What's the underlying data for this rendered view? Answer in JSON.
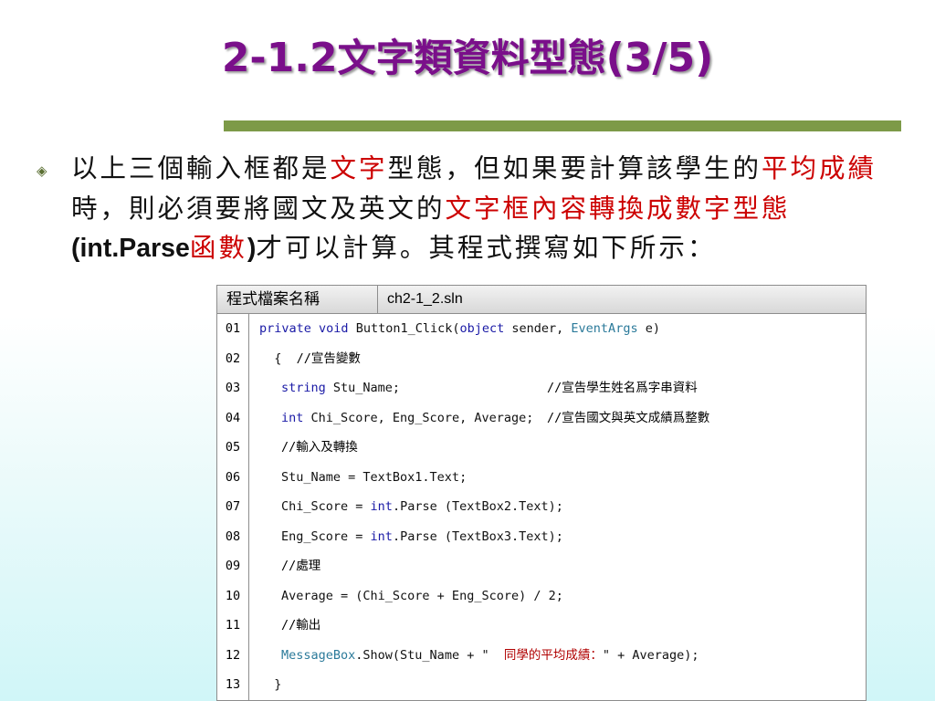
{
  "slide": {
    "title_prefix": "2-1.2",
    "title_cn": "文字類資料型態",
    "title_suffix": "(3/5)",
    "bullet_icon": "diamond-bullet-icon",
    "paragraph": {
      "p1": "以上三個輸入框都是",
      "p2_red": "文字",
      "p3": "型態，但如果要計算該學生的",
      "p4_red": "平均成績",
      "p5": "時，則必須要將國文及英文的",
      "p6_red": "文字框內容轉換成數字型態",
      "p7_paren_open": "(",
      "p8_en": "int.Parse",
      "p9_red": "函數",
      "p10_paren_close": ")",
      "p11": "才可以計算。其程式撰寫如下所示："
    }
  },
  "code_window": {
    "label": "程式檔案名稱",
    "filename": "ch2-1_2.sln",
    "line_numbers": [
      "01",
      "02",
      "03",
      "04",
      "05",
      "06",
      "07",
      "08",
      "09",
      "10",
      "11",
      "12",
      "13"
    ],
    "lines": {
      "l01": {
        "kw1": "private",
        "kw2": "void",
        "rest1": " Button1_Click(",
        "kw3": "object",
        "rest2": " sender, ",
        "ty": "EventArgs",
        "rest3": " e)"
      },
      "l02": {
        "rest": "  {  ",
        "cm": "//宣告變數"
      },
      "l03": {
        "kw": "string",
        "rest": " Stu_Name;",
        "cm": "//宣告學生姓名爲字串資料"
      },
      "l04": {
        "kw": "int",
        "rest": " Chi_Score, Eng_Score, Average;",
        "cm": "//宣告國文與英文成績爲整數"
      },
      "l05": {
        "cm": "//輸入及轉換"
      },
      "l06": {
        "rest": "Stu_Name = TextBox1.Text;"
      },
      "l07": {
        "rest1": "Chi_Score = ",
        "kw": "int",
        "rest2": ".Parse (TextBox2.Text);"
      },
      "l08": {
        "rest1": "Eng_Score = ",
        "kw": "int",
        "rest2": ".Parse (TextBox3.Text);"
      },
      "l09": {
        "cm": "//處理"
      },
      "l10": {
        "rest": "Average = (Chi_Score + Eng_Score) / 2;"
      },
      "l11": {
        "cm": "//輸出"
      },
      "l12": {
        "ty": "MessageBox",
        "rest1": ".Show(Stu_Name + \"  ",
        "str": "同學的平均成績：",
        "rest2": "\" + Average);"
      },
      "l13": {
        "rest": "  }"
      }
    }
  },
  "colors": {
    "title": "#7a0f8a",
    "divider": "#7d9a48",
    "highlight": "#cc0000",
    "keyword": "#1a1aa6",
    "type": "#2b7a9a"
  }
}
